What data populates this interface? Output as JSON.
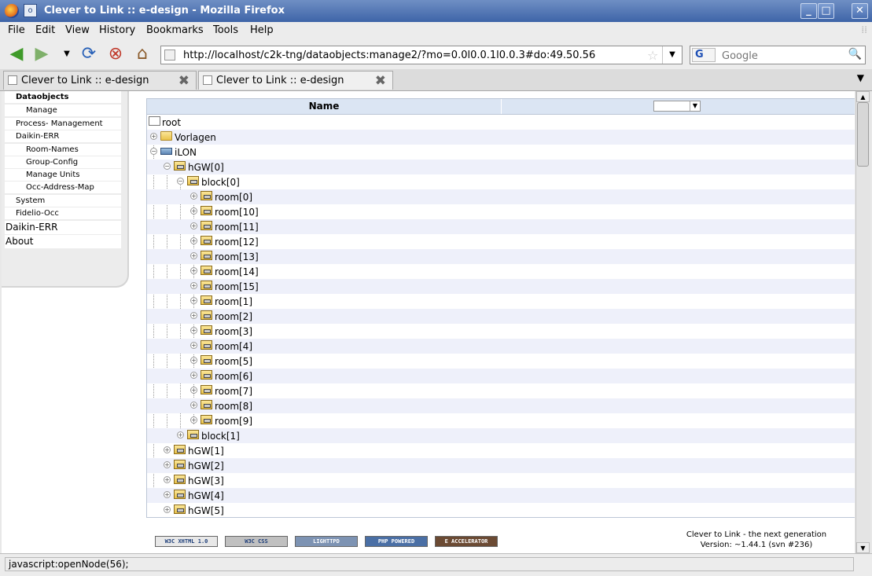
{
  "window": {
    "title": "Clever to Link :: e-design - Mozilla Firefox"
  },
  "menu": [
    "File",
    "Edit",
    "View",
    "History",
    "Bookmarks",
    "Tools",
    "Help"
  ],
  "toolbar": {
    "url": "http://localhost/c2k-tng/dataobjects:manage2/?mo=0.0l0.0.1l0.0.3#do:49.50.56",
    "search_engine": "G",
    "search_placeholder": "Google"
  },
  "tabs": [
    {
      "label": "Clever to Link :: e-design"
    },
    {
      "label": "Clever to Link :: e-design"
    }
  ],
  "sidebar": {
    "items": [
      {
        "label": "Dataobjects"
      },
      {
        "label": "Manage"
      },
      {
        "label": "Process- Management"
      },
      {
        "label": "Daikin-ERR"
      },
      {
        "label": "Room-Names"
      },
      {
        "label": "Group-Config"
      },
      {
        "label": "Manage Units"
      },
      {
        "label": "Occ-Address-Map"
      },
      {
        "label": "System"
      },
      {
        "label": "Fidelio-Occ"
      },
      {
        "label": "Daikin-ERR"
      },
      {
        "label": "About"
      }
    ]
  },
  "grid": {
    "column_name": "Name",
    "rows": [
      {
        "label": "root"
      },
      {
        "label": "Vorlagen"
      },
      {
        "label": "iLON"
      },
      {
        "label": "hGW[0]"
      },
      {
        "label": "block[0]"
      },
      {
        "label": "room[0]"
      },
      {
        "label": "room[10]"
      },
      {
        "label": "room[11]"
      },
      {
        "label": "room[12]"
      },
      {
        "label": "room[13]"
      },
      {
        "label": "room[14]"
      },
      {
        "label": "room[15]"
      },
      {
        "label": "room[1]"
      },
      {
        "label": "room[2]"
      },
      {
        "label": "room[3]"
      },
      {
        "label": "room[4]"
      },
      {
        "label": "room[5]"
      },
      {
        "label": "room[6]"
      },
      {
        "label": "room[7]"
      },
      {
        "label": "room[8]"
      },
      {
        "label": "room[9]"
      },
      {
        "label": "block[1]"
      },
      {
        "label": "hGW[1]"
      },
      {
        "label": "hGW[2]"
      },
      {
        "label": "hGW[3]"
      },
      {
        "label": "hGW[4]"
      },
      {
        "label": "hGW[5]"
      }
    ]
  },
  "footer": {
    "badges": [
      "W3C XHTML 1.0",
      "W3C CSS",
      "LIGHTTPD",
      "PHP POWERED",
      "E ACCELERATOR"
    ],
    "tagline": "Clever to Link - the next generation",
    "version": "Version: ~1.44.1 (svn #236)"
  },
  "status": {
    "text": "javascript:openNode(56);"
  }
}
